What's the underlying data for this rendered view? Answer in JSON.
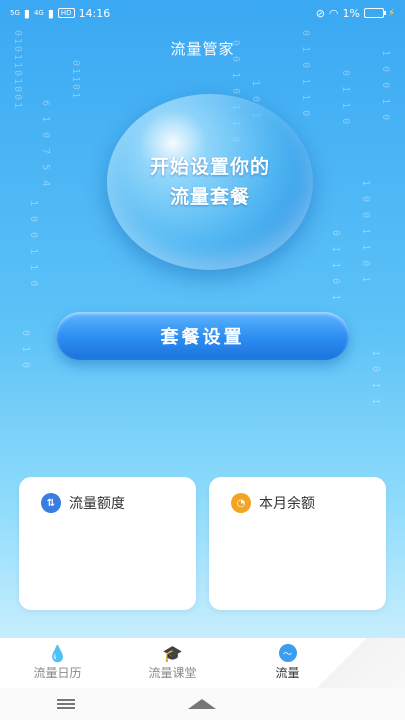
{
  "status_bar": {
    "time": "14:16",
    "network_left": "5G",
    "network_right": "4G",
    "nfc": "HD",
    "battery": "1%"
  },
  "app": {
    "title": "流量管家"
  },
  "bubble": {
    "line1": "开始设置你的",
    "line2": "流量套餐"
  },
  "setup_button": {
    "label": "套餐设置"
  },
  "cards": {
    "quota": {
      "title": "流量额度"
    },
    "balance": {
      "title": "本月余额"
    }
  },
  "tabs": [
    {
      "label": "流量日历",
      "icon": "water-drop-icon"
    },
    {
      "label": "流量课堂",
      "icon": "graduation-cap-icon"
    },
    {
      "label": "流量",
      "icon": "wave-icon",
      "active": true
    }
  ],
  "colors": {
    "primary": "#2b8cf0",
    "background_top": "#3aa8f2",
    "accent_orange": "#f3a420"
  }
}
